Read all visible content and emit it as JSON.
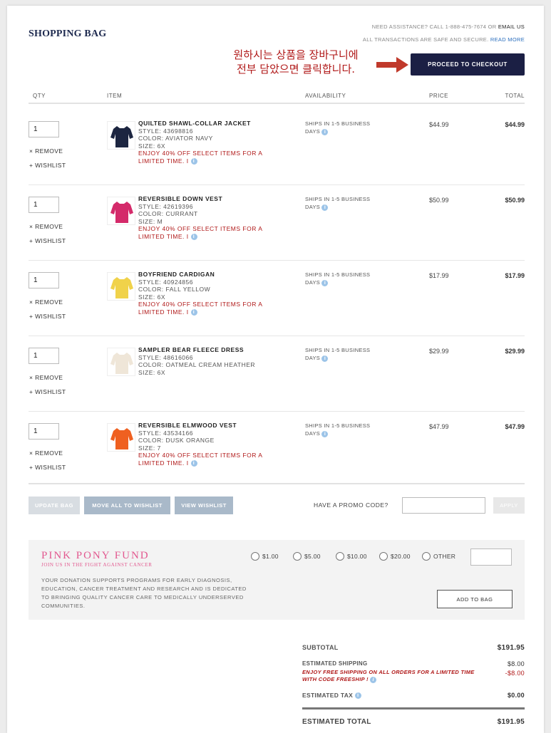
{
  "header": {
    "title": "SHOPPING BAG",
    "assist_text": "NEED ASSISTANCE? CALL 1-888-475-7674 OR ",
    "email_link": "EMAIL US",
    "secure_text": "ALL TRANSACTIONS ARE SAFE AND SECURE. ",
    "read_more": "READ MORE",
    "annotation_line1": "원하시는 상품을 장바구니에",
    "annotation_line2": "전부 담았으면 클릭합니다.",
    "checkout_label": "PROCEED TO CHECKOUT"
  },
  "columns": {
    "qty": "QTY",
    "item": "ITEM",
    "availability": "AVAILABILITY",
    "price": "PRICE",
    "total": "TOTAL"
  },
  "labels": {
    "remove": "× REMOVE",
    "wishlist": "+ WISHLIST",
    "style": "STYLE:",
    "color": "COLOR:",
    "size": "SIZE:"
  },
  "items": [
    {
      "qty": "1",
      "name": "QUILTED SHAWL-COLLAR JACKET",
      "style": "43698816",
      "color": "AVIATOR NAVY",
      "size": "6X",
      "promo": "ENJOY 40% OFF SELECT ITEMS FOR A LIMITED TIME. I",
      "availability": "SHIPS IN 1-5 BUSINESS DAYS",
      "price": "$44.99",
      "total": "$44.99",
      "swatch": "#1c2540"
    },
    {
      "qty": "1",
      "name": "REVERSIBLE DOWN VEST",
      "style": "42619396",
      "color": "CURRANT",
      "size": "M",
      "promo": "ENJOY 40% OFF SELECT ITEMS FOR A LIMITED TIME. I",
      "availability": "SHIPS IN 1-5 BUSINESS DAYS",
      "price": "$50.99",
      "total": "$50.99",
      "swatch": "#d42a6a"
    },
    {
      "qty": "1",
      "name": "BOYFRIEND CARDIGAN",
      "style": "40924856",
      "color": "FALL YELLOW",
      "size": "6X",
      "promo": "ENJOY 40% OFF SELECT ITEMS FOR A LIMITED TIME. I",
      "availability": "SHIPS IN 1-5 BUSINESS DAYS",
      "price": "$17.99",
      "total": "$17.99",
      "swatch": "#f0d24a"
    },
    {
      "qty": "1",
      "name": "SAMPLER BEAR FLEECE DRESS",
      "style": "48616066",
      "color": "OATMEAL CREAM HEATHER",
      "size": "6X",
      "promo": "",
      "availability": "SHIPS IN 1-5 BUSINESS DAYS",
      "price": "$29.99",
      "total": "$29.99",
      "swatch": "#efe6d8"
    },
    {
      "qty": "1",
      "name": "REVERSIBLE ELMWOOD VEST",
      "style": "43534166",
      "color": "DUSK ORANGE",
      "size": "7",
      "promo": "ENJOY 40% OFF SELECT ITEMS FOR A LIMITED TIME. I",
      "availability": "SHIPS IN 1-5 BUSINESS DAYS",
      "price": "$47.99",
      "total": "$47.99",
      "swatch": "#ef6020"
    }
  ],
  "actions": {
    "update_bag": "UPDATE BAG",
    "move_all": "MOVE ALL TO WISHLIST",
    "view_wishlist": "VIEW WISHLIST",
    "promo_label": "HAVE A PROMO CODE?",
    "apply": "APPLY"
  },
  "fund": {
    "title": "PINK PONY FUND",
    "subtitle": "JOIN US IN THE FIGHT AGAINST CANCER",
    "description": "YOUR DONATION SUPPORTS PROGRAMS FOR EARLY DIAGNOSIS, EDUCATION, CANCER TREATMENT AND RESEARCH AND IS DEDICATED TO BRINGING QUALITY CANCER CARE TO MEDICALLY UNDERSERVED COMMUNITIES.",
    "options": [
      "$1.00",
      "$5.00",
      "$10.00",
      "$20.00",
      "OTHER"
    ],
    "add_to_bag": "ADD TO BAG"
  },
  "summary": {
    "subtotal_label": "SUBTOTAL",
    "subtotal": "$191.95",
    "shipping_label": "ESTIMATED SHIPPING",
    "shipping": "$8.00",
    "free_ship_note": "ENJOY FREE SHIPPING ON ALL ORDERS FOR A LIMITED TIME WITH CODE FREESHIP !",
    "shipping_discount": "-$8.00",
    "tax_label": "ESTIMATED TAX",
    "tax": "$0.00",
    "total_label": "ESTIMATED TOTAL",
    "total": "$191.95"
  }
}
